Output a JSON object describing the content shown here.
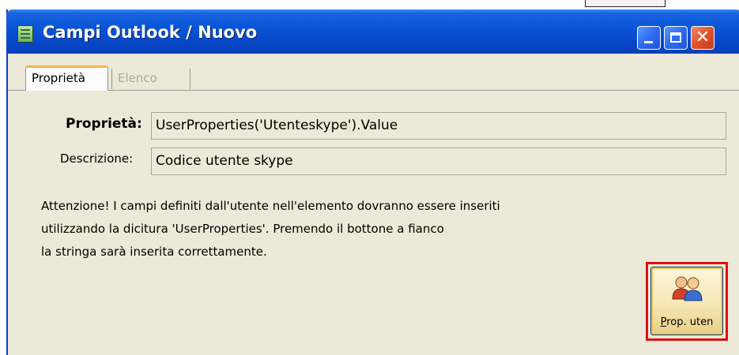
{
  "window": {
    "title": "Campi Outlook / Nuovo",
    "close_glyph": "✕"
  },
  "tabs": [
    {
      "label": "Proprietà",
      "active": true
    },
    {
      "label": "Elenco",
      "active": false
    }
  ],
  "form": {
    "property_label": "Proprietà:",
    "property_value": "UserProperties('Utenteskype').Value",
    "description_label": "Descrizione:",
    "description_value": "Codice utente skype"
  },
  "note": {
    "line1": "Attenzione! I campi definiti dall'utente nell'elemento dovranno essere inseriti",
    "line2": "utilizzando la dicitura 'UserProperties'. Premendo il bottone a fianco",
    "line3": "la stringa sarà inserita correttamente."
  },
  "user_prop_button": {
    "label_first": "P",
    "label_rest": "rop. uten",
    "icon": "users-icon",
    "highlighted": true
  },
  "colors": {
    "titlebar": "#0a55d8",
    "window_bg": "#ece9d8",
    "active_tab_accent": "#f0b94b",
    "highlight": "#e01010"
  }
}
